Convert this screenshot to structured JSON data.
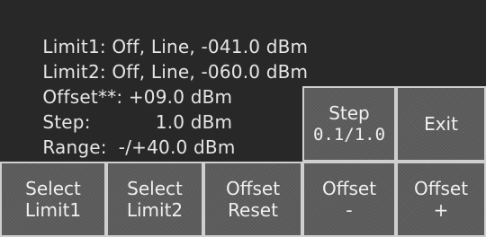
{
  "info": {
    "limit1": {
      "label": "Limit1:",
      "value": " Off, Line, -041.0 dBm"
    },
    "limit2": {
      "label": "Limit2:",
      "value": " Off, Line, -060.0 dBm"
    },
    "offset": {
      "label": "Offset**:",
      "value": " +09.0 dBm"
    },
    "step": {
      "label": "Step:",
      "value": "           1.0 dBm"
    },
    "range": {
      "label": "Range:",
      "value": "  -/+40.0 dBm"
    }
  },
  "buttons": {
    "step": {
      "line1": "Step",
      "line2": "0.1/1.0"
    },
    "exit": {
      "line1": "Exit"
    },
    "select_limit1": {
      "line1": "Select",
      "line2": "Limit1"
    },
    "select_limit2": {
      "line1": "Select",
      "line2": "Limit2"
    },
    "offset_reset": {
      "line1": "Offset",
      "line2": "Reset"
    },
    "offset_minus": {
      "line1": "Offset",
      "line2": "-"
    },
    "offset_plus": {
      "line1": "Offset",
      "line2": "+"
    }
  },
  "colors": {
    "background": "#282828",
    "text": "#e6e6e6",
    "button_fill": "#5c5c5c",
    "button_border": "#cfcfcf"
  }
}
